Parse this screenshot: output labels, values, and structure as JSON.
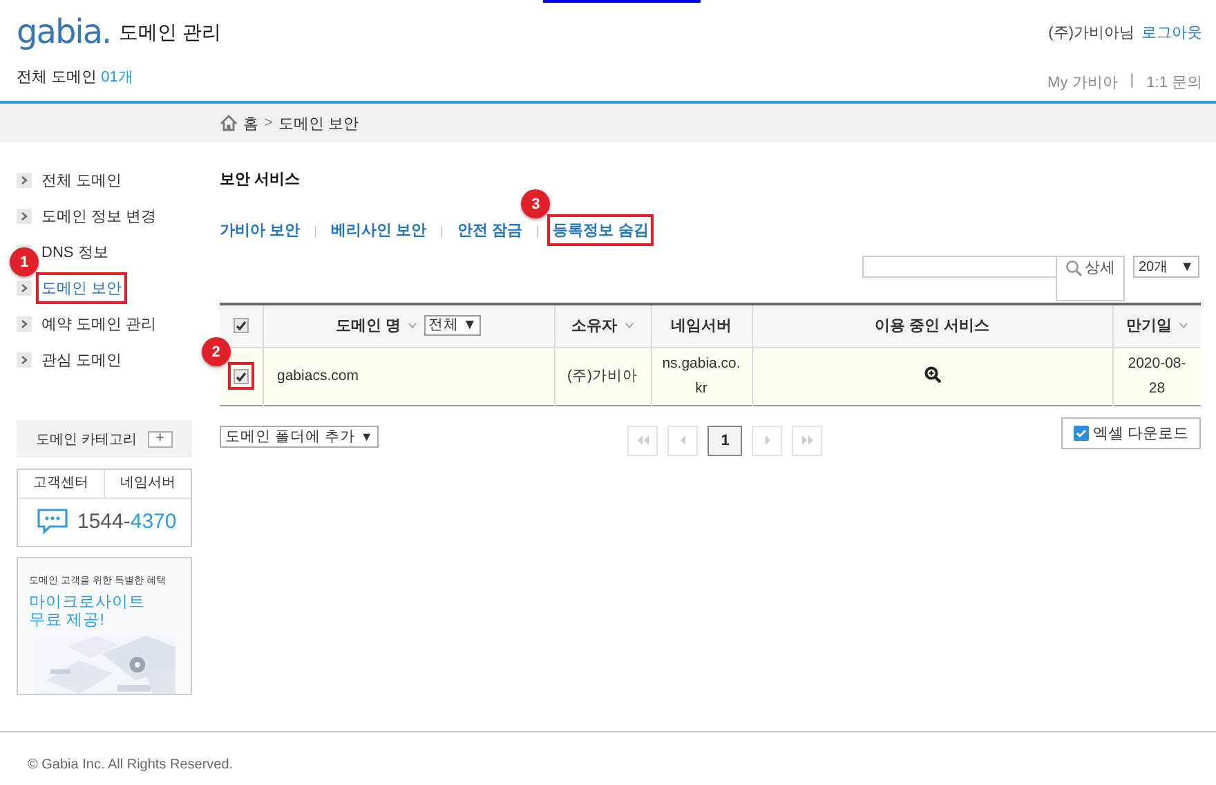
{
  "header": {
    "logo": "gabia.",
    "title": "도메인 관리",
    "user": "(주)가비아님",
    "logout": "로그아웃",
    "count_label": "전체 도메인",
    "count": "01개",
    "links": [
      "My 가비아",
      "1:1 문의"
    ],
    "link_separator": "|"
  },
  "breadcrumb": {
    "items": [
      "홈",
      "도메인 보안"
    ],
    "separator": ">"
  },
  "sidebar": {
    "items": [
      {
        "label": "전체 도메인",
        "selected": false
      },
      {
        "label": "도메인 정보 변경",
        "selected": false
      },
      {
        "label": "DNS 정보",
        "selected": false
      },
      {
        "label": "도메인 보안",
        "selected": true,
        "callout": "1"
      },
      {
        "label": "예약 도메인 관리",
        "selected": false
      },
      {
        "label": "관심 도메인",
        "selected": false
      }
    ],
    "category": "도메인 카테고리",
    "category_add": "+",
    "support_tabs": [
      "고객센터",
      "네임서버"
    ],
    "phone_prefix": "1544-",
    "phone_suffix": "4370",
    "promo": {
      "caption": "도메인 고객을 위한 특별한 혜택",
      "headline": "마이크로사이트",
      "headline_2": "무료 제공!"
    }
  },
  "section_title": "보안 서비스",
  "tabs": [
    {
      "label": "가비아 보안"
    },
    {
      "label": "베리사인 보안"
    },
    {
      "label": "안전 잠금"
    },
    {
      "label": "등록정보 숨김",
      "callout": "3"
    }
  ],
  "tab_separator": "|",
  "search": {
    "detail": "상세"
  },
  "page_size": {
    "value": "20개",
    "arrow": "▼"
  },
  "table": {
    "select_all": true,
    "columns": [
      {
        "label": "도메인 명",
        "sortable": true,
        "filter": "전체",
        "filter_arrow": "▼"
      },
      {
        "label": "소유자",
        "sortable": true
      },
      {
        "label": "네임서버",
        "sortable": false
      },
      {
        "label": "이용 중인 서비스",
        "sortable": false
      },
      {
        "label": "만기일",
        "sortable": true
      }
    ],
    "rows": [
      {
        "checked": true,
        "callout": "2",
        "domain": "gabiacs.com",
        "owner": "(주)가비아",
        "nameserver": "ns.gabia.co.kr",
        "expiry": "2020-08-28"
      }
    ]
  },
  "folder_select": {
    "label": "도메인 폴더에 추가",
    "arrow": "▼"
  },
  "pagination": {
    "pages": [
      {
        "label": "1",
        "selected": true
      }
    ]
  },
  "excel_button": "엑셀 다운로드",
  "footer": "© Gabia Inc. All Rights Reserved."
}
